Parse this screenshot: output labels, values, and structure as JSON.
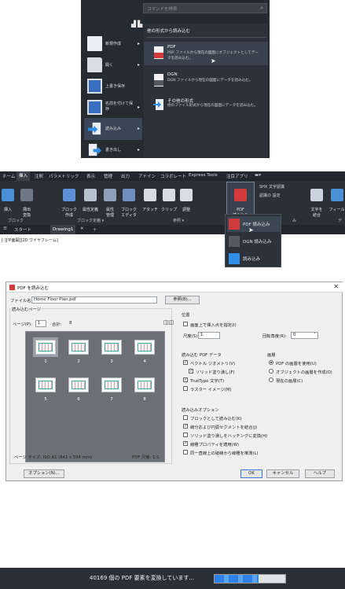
{
  "app_menu": {
    "search_placeholder": "コマンドを検索",
    "left_items": [
      {
        "label": "新規作成",
        "icon": "new-file-icon",
        "submenu": true
      },
      {
        "label": "開く",
        "icon": "open-folder-icon",
        "submenu": true
      },
      {
        "label": "上書き保存",
        "icon": "save-icon",
        "submenu": false
      },
      {
        "label": "名前を付けて保存",
        "icon": "save-as-icon",
        "submenu": true
      },
      {
        "label": "読み込み",
        "icon": "import-icon",
        "submenu": true
      },
      {
        "label": "書き出し",
        "icon": "export-icon",
        "submenu": true
      }
    ],
    "right_header": "他の形式から読み込む",
    "right_items": [
      {
        "title": "PDF",
        "desc": "PDF ファイルから現在の図面にオブジェクトとしてデータを読み込む。",
        "icon": "pdf-import-icon"
      },
      {
        "title": "DGN",
        "desc": "DGN ファイルから現在の図面にデータを読み込む。",
        "icon": "dgn-import-icon"
      },
      {
        "title": "その他の形式",
        "desc": "他のファイル形式から現在の図面にデータを読み込む。",
        "icon": "other-import-icon"
      }
    ]
  },
  "ribbon": {
    "tabs": [
      "ホーム",
      "挿入",
      "注釈",
      "パラメトリック",
      "表示",
      "管理",
      "出力",
      "アドイン",
      "コラボレート",
      "Express Tools",
      "注目アプリ"
    ],
    "active_tab": "挿入",
    "buttons": [
      {
        "label": "挿入"
      },
      {
        "label": "挿出\n変換"
      },
      {
        "label": "ブロック\n作成"
      },
      {
        "label": "属性定義"
      },
      {
        "label": "属性\n管理"
      },
      {
        "label": "ブロック\nエディタ"
      },
      {
        "label": "アタッチ"
      },
      {
        "label": "クリップ"
      },
      {
        "label": "調整"
      },
      {
        "label": "PDF\n読み込み"
      },
      {
        "label": "文字を\n結合"
      },
      {
        "label": "フィール"
      }
    ],
    "small_items": [
      "SHX 文字認識",
      "認識の 設定"
    ],
    "panel_labels": [
      "ブロック",
      "ブロック定義 ▾",
      "参照 ▾",
      "み",
      "デ"
    ],
    "pdf_dropdown": [
      "PDF 読み込み",
      "DGN 読み込み",
      "読み込み"
    ],
    "doc_tabs": [
      "スタート",
      "Drawing1"
    ],
    "viewport_label": "[-][平面図][2D ワイヤフレーム]"
  },
  "dialog": {
    "title": "PDF を読み込む",
    "file_name_label": "ファイル名:",
    "file_name_value": "Home Floor Plan.pdf",
    "browse_button": "参照(B)...",
    "pages_group": "読み込むページ",
    "page_label": "ページ(P):",
    "page_value": "1",
    "total_label": "合計:",
    "total_value": "8",
    "page_numbers": [
      "1",
      "2",
      "3",
      "4",
      "5",
      "6",
      "7",
      "8"
    ],
    "page_size": "ページ サイズ: ISO A1 (841 x 594 mm)",
    "pdf_scale": "PDF 尺度: 1:1",
    "position_group": "位置",
    "specify_on_screen": "画面上で挿入点を指定(I)",
    "scale_label": "尺度(S):",
    "scale_value": "1",
    "rotation_label": "回転角度(R):",
    "rotation_value": "0",
    "data_group": "読み込む PDF データ",
    "data_options": [
      {
        "label": "ベクトル ジオメトリ(V)",
        "checked": true
      },
      {
        "label": "ソリッド塗り潰し(F)",
        "checked": true
      },
      {
        "label": "TrueType 文字(T)",
        "checked": true
      },
      {
        "label": "ラスター イメージ(M)",
        "checked": false
      }
    ],
    "layers_group": "画層",
    "layer_options": [
      {
        "label": "PDF の画層を使用(U)",
        "selected": true
      },
      {
        "label": "オブジェクトの画層を作成(O)",
        "selected": false
      },
      {
        "label": "現在の画層(C)",
        "selected": false
      }
    ],
    "import_options_group": "読み込みオプション",
    "import_options": [
      {
        "label": "ブロックとして読み込む(K)",
        "checked": false
      },
      {
        "label": "線分および円弧セグメントを結合(J)",
        "checked": true
      },
      {
        "label": "ソリッド塗り潰しをハッチングに変換(H)",
        "checked": false
      },
      {
        "label": "線種プロパティを適用(W)",
        "checked": true
      },
      {
        "label": "同一直線上の破線から線種を推測(L)",
        "checked": false
      }
    ],
    "options_button": "オプション(N)...",
    "ok_button": "OK",
    "cancel_button": "キャンセル",
    "help_button": "ヘルプ"
  },
  "progress": {
    "text": "40169 個の PDF 要素を変換しています...",
    "fraction": 0.62
  }
}
